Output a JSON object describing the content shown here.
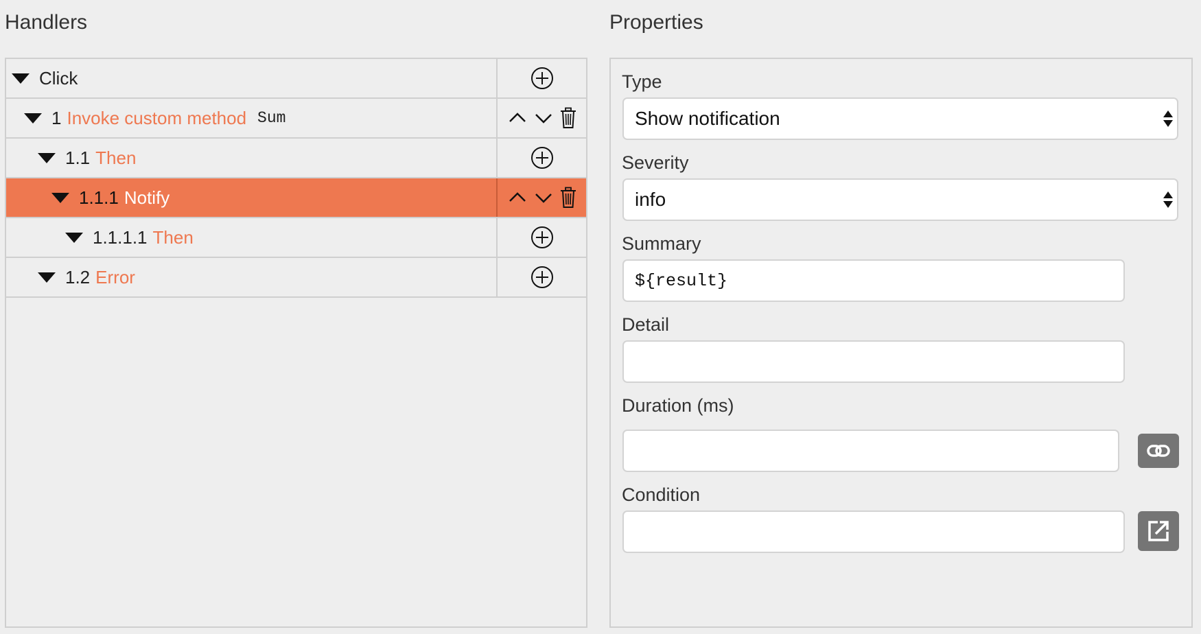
{
  "handlers": {
    "title": "Handlers",
    "rows": [
      {
        "num": "",
        "kind": "",
        "label": "Click",
        "arg": "",
        "actions": "add",
        "selected": false
      },
      {
        "num": "1",
        "kind": "Invoke custom method",
        "label": "",
        "arg": "Sum",
        "actions": "move-delete",
        "selected": false
      },
      {
        "num": "1.1",
        "kind": "Then",
        "label": "",
        "arg": "",
        "actions": "add",
        "selected": false
      },
      {
        "num": "1.1.1",
        "kind": "Notify",
        "label": "",
        "arg": "",
        "actions": "move-delete",
        "selected": true
      },
      {
        "num": "1.1.1.1",
        "kind": "Then",
        "label": "",
        "arg": "",
        "actions": "add",
        "selected": false
      },
      {
        "num": "1.2",
        "kind": "Error",
        "label": "",
        "arg": "",
        "actions": "add",
        "selected": false
      }
    ],
    "icons": {
      "expand": "caret-down-icon",
      "add": "plus-circle-icon",
      "move_up": "chevron-up-icon",
      "move_down": "chevron-down-icon",
      "delete": "trash-icon"
    }
  },
  "properties": {
    "title": "Properties",
    "type": {
      "label": "Type",
      "value": "Show notification"
    },
    "severity": {
      "label": "Severity",
      "value": "info"
    },
    "summary": {
      "label": "Summary",
      "value": "${result}"
    },
    "detail": {
      "label": "Detail",
      "value": ""
    },
    "duration": {
      "label": "Duration (ms)",
      "value": "",
      "button_icon": "link-icon"
    },
    "condition": {
      "label": "Condition",
      "value": "",
      "button_icon": "external-edit-icon"
    }
  },
  "colors": {
    "accent": "#ee7850",
    "background": "#eeeeee",
    "border": "#cfcfcf",
    "button_gray": "#757575"
  }
}
